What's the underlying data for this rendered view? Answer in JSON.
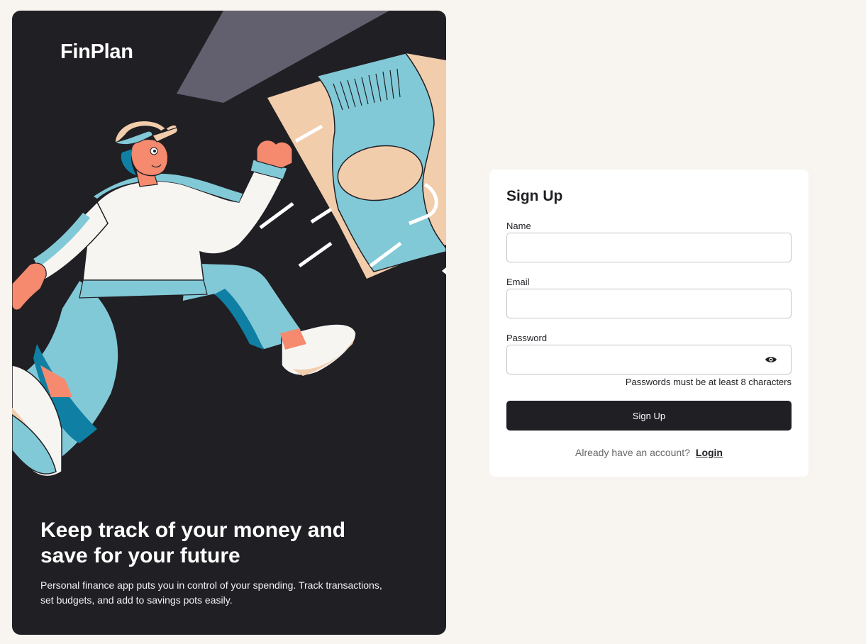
{
  "brand": {
    "logo": "FinPlan"
  },
  "hero": {
    "title": "Keep track of your money and save for your future",
    "description": "Personal finance app puts you in control of your spending. Track transactions, set budgets, and add to savings pots easily."
  },
  "form": {
    "title": "Sign Up",
    "name_label": "Name",
    "email_label": "Email",
    "password_label": "Password",
    "name_value": "",
    "email_value": "",
    "password_value": "",
    "password_hint": "Passwords must be at least 8 characters",
    "submit_label": "Sign Up",
    "login_prompt": "Already have an account?",
    "login_link": "Login",
    "password_toggle_icon": "eye-icon"
  },
  "colors": {
    "background": "#f8f4f0",
    "dark": "#201f24",
    "card": "#ffffff",
    "accent_blue": "#82c9d7",
    "accent_peach": "#f2cdac",
    "accent_coral": "#f58a6e"
  }
}
